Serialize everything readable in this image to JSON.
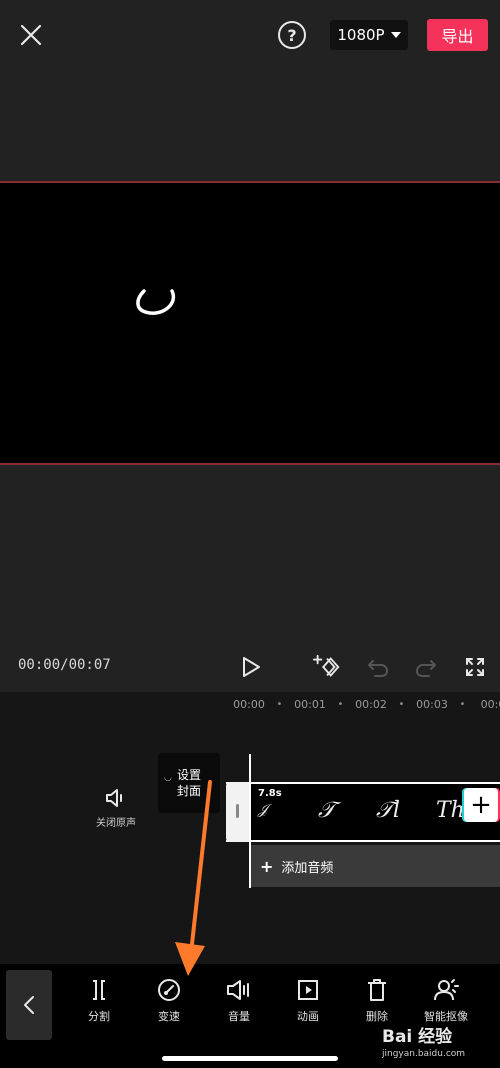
{
  "top_bar": {
    "help_symbol": "?",
    "resolution": "1080P",
    "export_label": "导出"
  },
  "controls": {
    "time": "00:00/00:07"
  },
  "timeline": {
    "ruler": [
      "00:00",
      "00:01",
      "00:02",
      "00:03",
      "00:0"
    ],
    "mute_label": "关闭原声",
    "cover_label": "设置封面",
    "clip_duration": "7.8s",
    "clip_frames": [
      "𝒥",
      "𝒯",
      "𝒯l",
      "The"
    ],
    "add_audio_label": "添加音频",
    "add_audio_symbol": "+",
    "add_clip_symbol": "+"
  },
  "toolbar": {
    "tools": [
      {
        "label": "分割",
        "icon": "split-icon"
      },
      {
        "label": "变速",
        "icon": "speed-icon"
      },
      {
        "label": "音量",
        "icon": "volume-icon"
      },
      {
        "label": "动画",
        "icon": "animation-icon"
      },
      {
        "label": "删除",
        "icon": "delete-icon"
      },
      {
        "label": "智能抠像",
        "icon": "smart-cutout-icon"
      }
    ]
  },
  "watermark": {
    "brand": "Bai 经验",
    "url": "jingyan.baidu.com"
  },
  "colors": {
    "export": "#f5335a",
    "preview_border": "#8a2b34",
    "annotation_arrow": "#ff7a2a"
  }
}
